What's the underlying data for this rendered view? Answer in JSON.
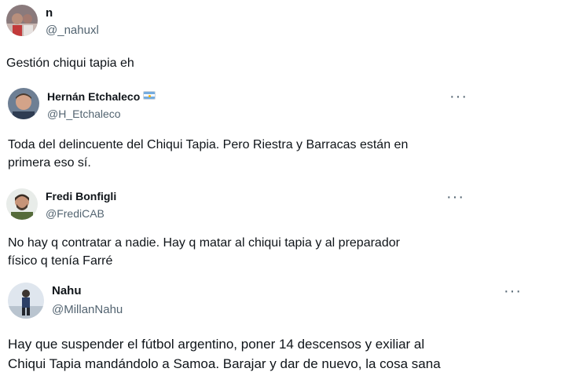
{
  "main_post": {
    "name": "n",
    "handle": "@_nahuxl",
    "text": "Gestión chiqui tapia eh"
  },
  "replies": [
    {
      "name": "Hernán Etchaleco",
      "handle": "@H_Etchaleco",
      "line1": "Toda del delincuente del Chiqui Tapia. Pero Riestra y Barracas están en",
      "line2": "primera eso sí.",
      "flag_icon": "argentina-flag-icon"
    },
    {
      "name": "Fredi Bonfigli",
      "handle": "@FrediCAB",
      "line1": "No hay q contratar a nadie. Hay q matar al chiqui tapia y al preparador",
      "line2": "físico q tenía Farré"
    },
    {
      "name": "Nahu",
      "handle": "@MillanNahu",
      "line1": "Hay que suspender el fútbol argentino, poner 14 descensos y exiliar al",
      "line2": "Chiqui Tapia mandándolo a Samoa. Barajar y dar de nuevo, la cosa sana"
    }
  ],
  "more_glyph": "···",
  "colors": {
    "text": "#0f1419",
    "secondary": "#536471",
    "background": "#ffffff"
  }
}
